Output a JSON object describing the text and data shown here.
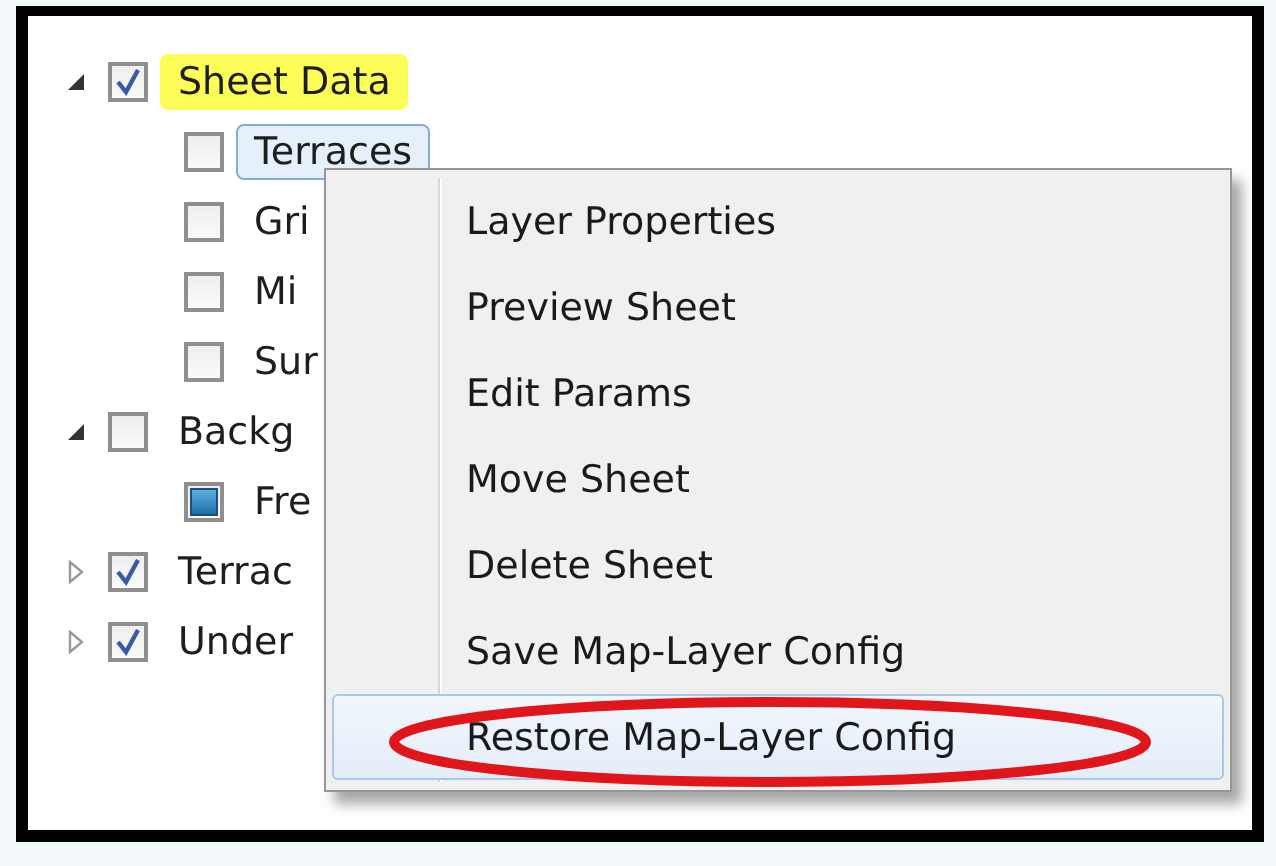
{
  "tree": [
    {
      "label": "Sheet Data",
      "checked": true,
      "partial": false,
      "expanded": true,
      "highlighted": true,
      "selected": false,
      "children": [
        {
          "label": "Terraces",
          "checked": false,
          "partial": false,
          "highlighted": false,
          "selected": true
        },
        {
          "label": "Gri",
          "checked": false,
          "partial": false,
          "highlighted": false,
          "selected": false
        },
        {
          "label": "Mi",
          "checked": false,
          "partial": false,
          "highlighted": false,
          "selected": false
        },
        {
          "label": "Sur",
          "checked": false,
          "partial": false,
          "highlighted": false,
          "selected": false
        }
      ]
    },
    {
      "label": "Backg",
      "checked": false,
      "partial": false,
      "expanded": true,
      "highlighted": false,
      "selected": false,
      "children": [
        {
          "label": "Fre",
          "checked": false,
          "partial": true,
          "highlighted": false,
          "selected": false
        }
      ]
    },
    {
      "label": "Terrac",
      "checked": true,
      "partial": false,
      "expanded": false,
      "highlighted": false,
      "selected": false
    },
    {
      "label": "Under",
      "checked": true,
      "partial": false,
      "expanded": false,
      "highlighted": false,
      "selected": false
    }
  ],
  "context_menu": [
    {
      "label": "Layer Properties",
      "selected": false,
      "circled": false
    },
    {
      "label": "Preview Sheet",
      "selected": false,
      "circled": false
    },
    {
      "label": "Edit Params",
      "selected": false,
      "circled": false
    },
    {
      "label": "Move Sheet",
      "selected": false,
      "circled": false
    },
    {
      "label": "Delete Sheet",
      "selected": false,
      "circled": false
    },
    {
      "label": "Save Map-Layer Config",
      "selected": false,
      "circled": false
    },
    {
      "label": "Restore Map-Layer Config",
      "selected": true,
      "circled": true
    }
  ]
}
